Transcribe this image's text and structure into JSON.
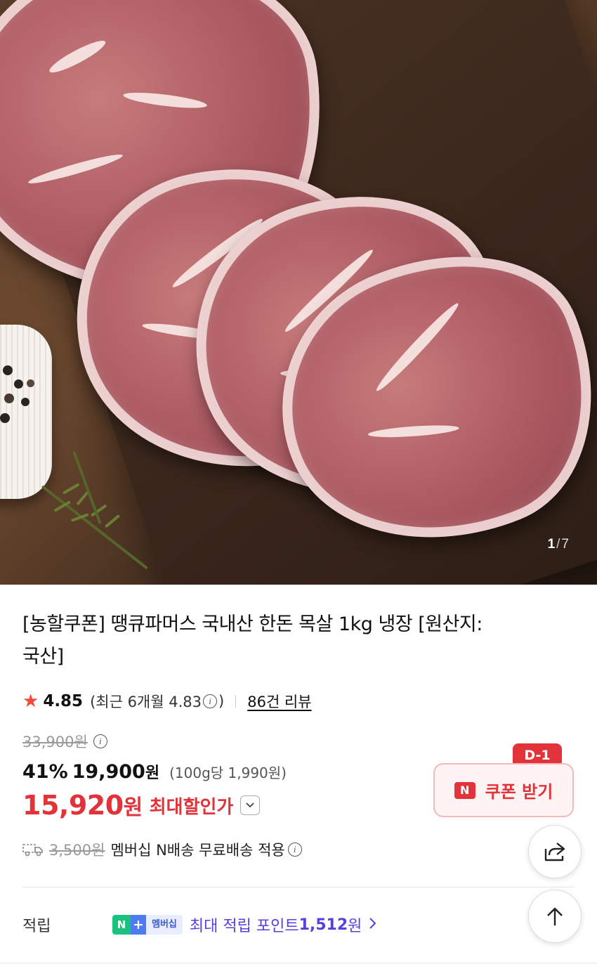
{
  "gallery": {
    "current": "1",
    "separator": "/",
    "total": "7"
  },
  "product": {
    "title": "[농할쿠폰] 땡큐파머스 국내산 한돈 목살 1kg 냉장 [원산지:국산]",
    "rating_score": "4.85",
    "rating_recent": "(최근 6개월 4.83",
    "rating_recent_close": ")",
    "reviews_link": "86건 리뷰",
    "original_price": "33,900원",
    "discount_percent": "41%",
    "sale_price": "19,900",
    "won": "원",
    "unit_price": "(100g당 1,990원)",
    "max_discount_price": "15,920",
    "max_discount_won": "원",
    "max_discount_label": "최대할인가"
  },
  "coupon": {
    "badge": "D-1",
    "logo": "N",
    "label": "쿠폰 받기"
  },
  "shipping": {
    "original_fee": "3,500원",
    "text": "멤버십 N배송 무료배송 적용"
  },
  "points": {
    "label": "적립",
    "badge_n": "N",
    "badge_plus": "+",
    "badge_membership": "멤버십",
    "text": "최대 적립 포인트 ",
    "amount": "1,512",
    "won": "원"
  },
  "colors": {
    "accent_red": "#e2323a",
    "star": "#f04a3a",
    "points_purple": "#5a3ee0",
    "naver_green": "#19c37d"
  },
  "icons": [
    "star-icon",
    "info-icon",
    "chevron-down-icon",
    "truck-icon",
    "share-icon",
    "arrow-up-icon",
    "chevron-right-icon"
  ]
}
